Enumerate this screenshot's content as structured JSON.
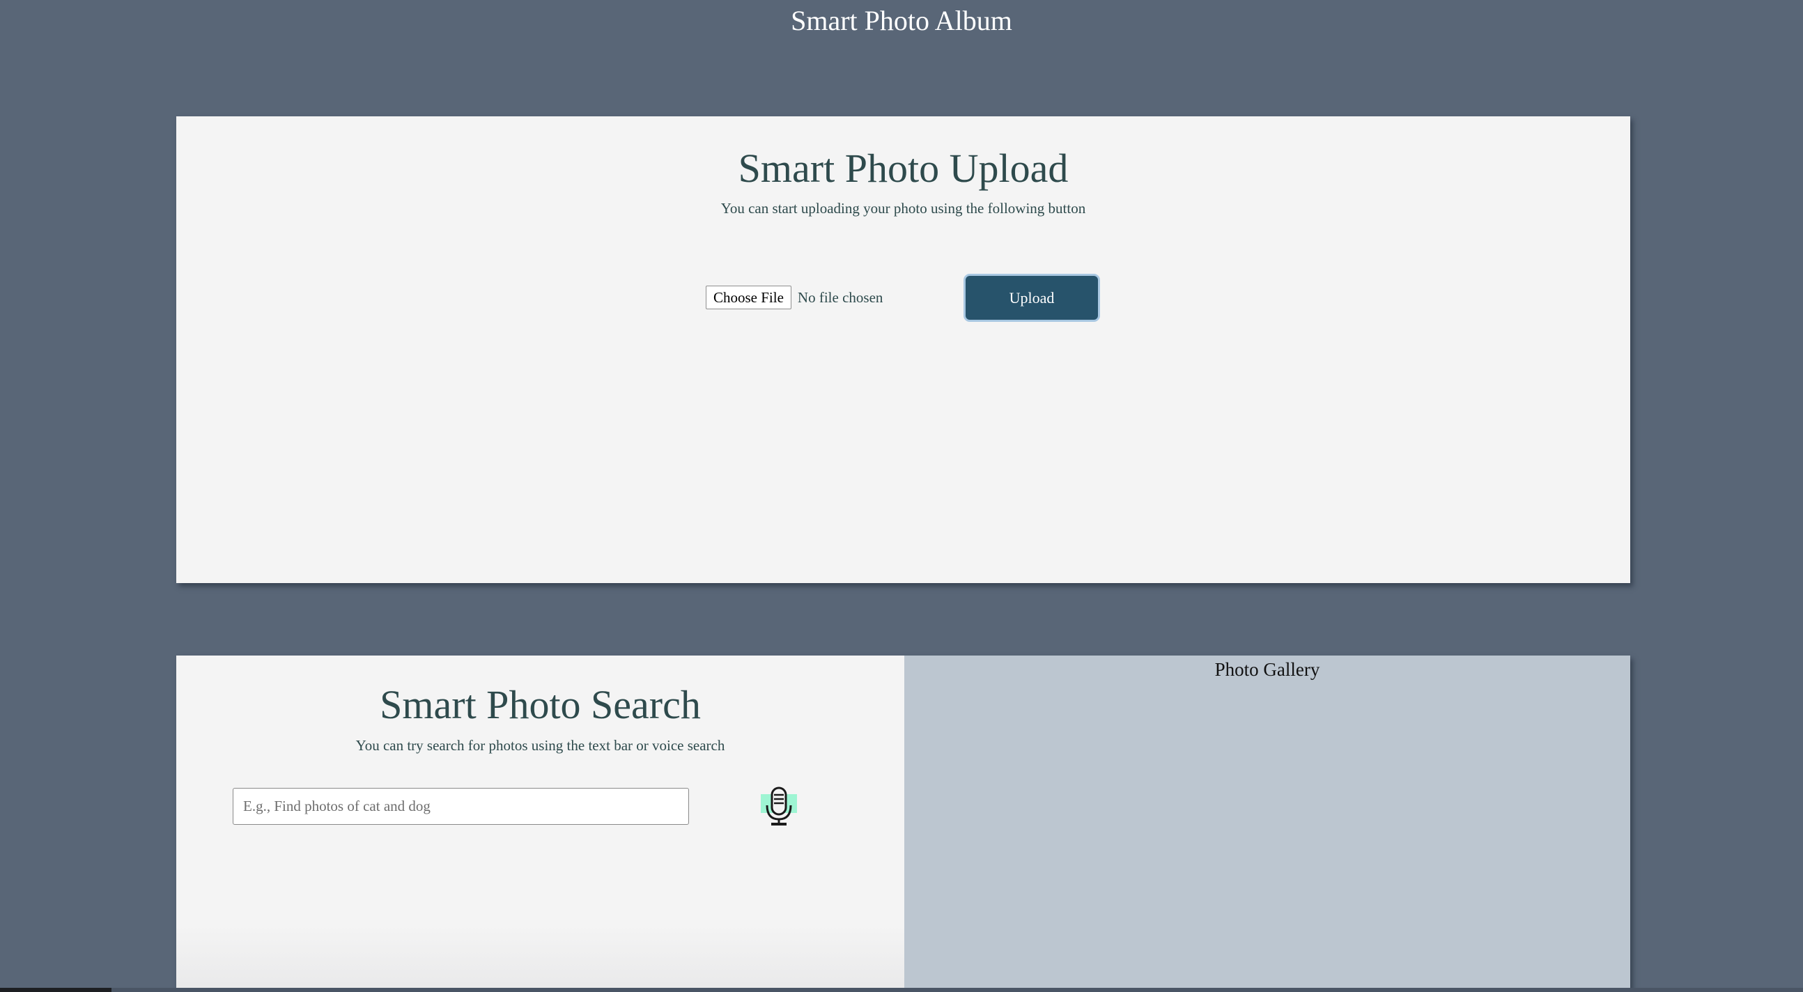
{
  "app": {
    "title": "Smart Photo Album"
  },
  "upload": {
    "title": "Smart Photo Upload",
    "subtitle": "You can start uploading your photo using the following button",
    "choose_file_label": "Choose File",
    "file_status": "No file chosen",
    "upload_label": "Upload"
  },
  "search": {
    "title": "Smart Photo Search",
    "subtitle": "You can try search for photos using the text bar or voice search",
    "placeholder": "E.g., Find photos of cat and dog",
    "value": "",
    "mic_icon": "microphone-icon"
  },
  "gallery": {
    "title": "Photo Gallery"
  },
  "colors": {
    "page_background": "#596677",
    "panel_background": "#f4f4f4",
    "gallery_background": "#bcc6d0",
    "heading_text": "#2e4a4c",
    "upload_button": "#27536b",
    "mic_highlight": "#9ef5d3"
  }
}
